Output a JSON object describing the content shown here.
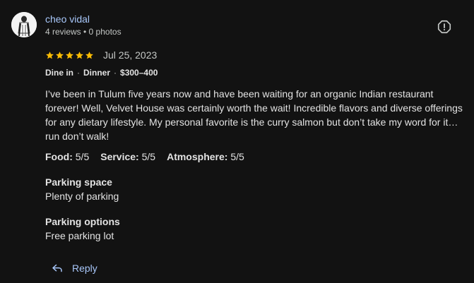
{
  "reviewer": {
    "name": "cheo vidal",
    "meta": "4 reviews • 0 photos"
  },
  "rating": {
    "stars": 5,
    "max_stars": 5,
    "date": "Jul 25, 2023"
  },
  "details": {
    "service_type": "Dine in",
    "meal": "Dinner",
    "price": "$300–400"
  },
  "review": {
    "text": "I’ve been in Tulum five years now and have been waiting for an organic Indian restaurant forever! Well, Velvet House was certainly worth the wait! Incredible flavors and diverse offerings for any dietary lifestyle. My personal favorite is the curry salmon but don’t take my word for it…run don’t walk!"
  },
  "sub_ratings": [
    {
      "label": "Food:",
      "value": "5/5"
    },
    {
      "label": "Service:",
      "value": "5/5"
    },
    {
      "label": "Atmosphere:",
      "value": "5/5"
    }
  ],
  "attributes": [
    {
      "title": "Parking space",
      "value": "Plenty of parking"
    },
    {
      "title": "Parking options",
      "value": "Free parking lot"
    }
  ],
  "actions": {
    "reply_label": "Reply"
  },
  "icons": {
    "report": "report-icon",
    "reply": "reply-arrow-icon",
    "star": "star-icon"
  },
  "colors": {
    "background": "#121212",
    "accent": "#a8c7fa",
    "star": "#fbbc04",
    "text": "#e3e3e3",
    "muted": "#c4c7c5"
  }
}
